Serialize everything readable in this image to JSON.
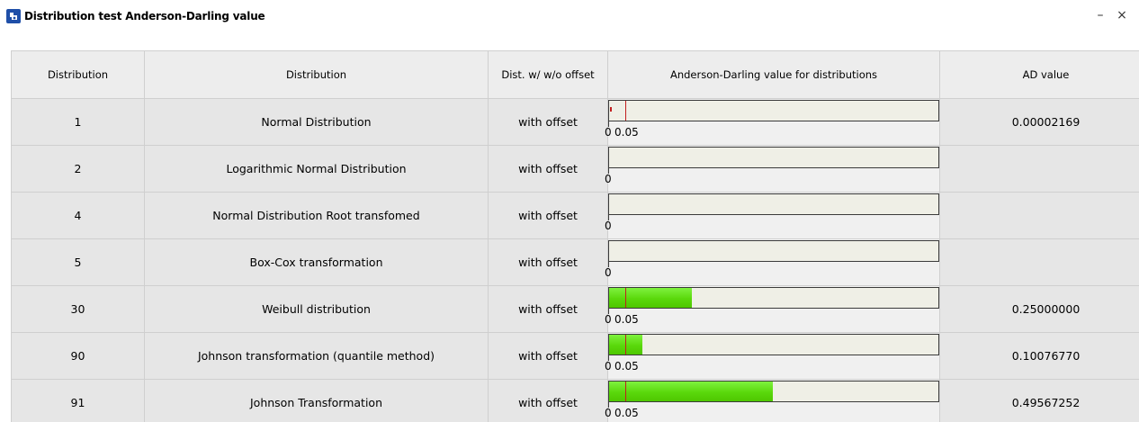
{
  "window": {
    "title": "Distribution test Anderson-Darling value",
    "icon": "app-icon",
    "minimize_label": "–",
    "close_label": "×"
  },
  "table": {
    "headers": [
      "Distribution",
      "Distribution",
      "Dist. w/ w/o offset",
      "Anderson-Darling value for distributions",
      "AD value"
    ],
    "rows": [
      {
        "id": "1",
        "name": "Normal Distribution",
        "offset": "with offset",
        "ad_value": "0.00002169",
        "ad_fraction": 2.169e-05,
        "zero_label": "0",
        "threshold_label": "0.05",
        "threshold_fraction": 0.05
      },
      {
        "id": "2",
        "name": "Logarithmic Normal Distribution",
        "offset": "with offset",
        "ad_value": "",
        "ad_fraction": 0,
        "zero_label": "0",
        "threshold_label": "",
        "threshold_fraction": null
      },
      {
        "id": "4",
        "name": "Normal Distribution Root transfomed",
        "offset": "with offset",
        "ad_value": "",
        "ad_fraction": 0,
        "zero_label": "0",
        "threshold_label": "",
        "threshold_fraction": null
      },
      {
        "id": "5",
        "name": "Box-Cox transformation",
        "offset": "with offset",
        "ad_value": "",
        "ad_fraction": 0,
        "zero_label": "0",
        "threshold_label": "",
        "threshold_fraction": null
      },
      {
        "id": "30",
        "name": "Weibull distribution",
        "offset": "with offset",
        "ad_value": "0.25000000",
        "ad_fraction": 0.25,
        "zero_label": "0",
        "threshold_label": "0.05",
        "threshold_fraction": 0.05
      },
      {
        "id": "90",
        "name": "Johnson transformation (quantile method)",
        "offset": "with offset",
        "ad_value": "0.10076770",
        "ad_fraction": 0.1007677,
        "zero_label": "0",
        "threshold_label": "0.05",
        "threshold_fraction": 0.05
      },
      {
        "id": "91",
        "name": "Johnson Transformation",
        "offset": "with offset",
        "ad_value": "0.49567252",
        "ad_fraction": 0.49567252,
        "zero_label": "0",
        "threshold_label": "0.05",
        "threshold_fraction": 0.05
      }
    ]
  },
  "colors": {
    "bar_fill": "#5ad80c",
    "threshold_line": "#c21e1e",
    "bar_track": "#efefe6"
  }
}
